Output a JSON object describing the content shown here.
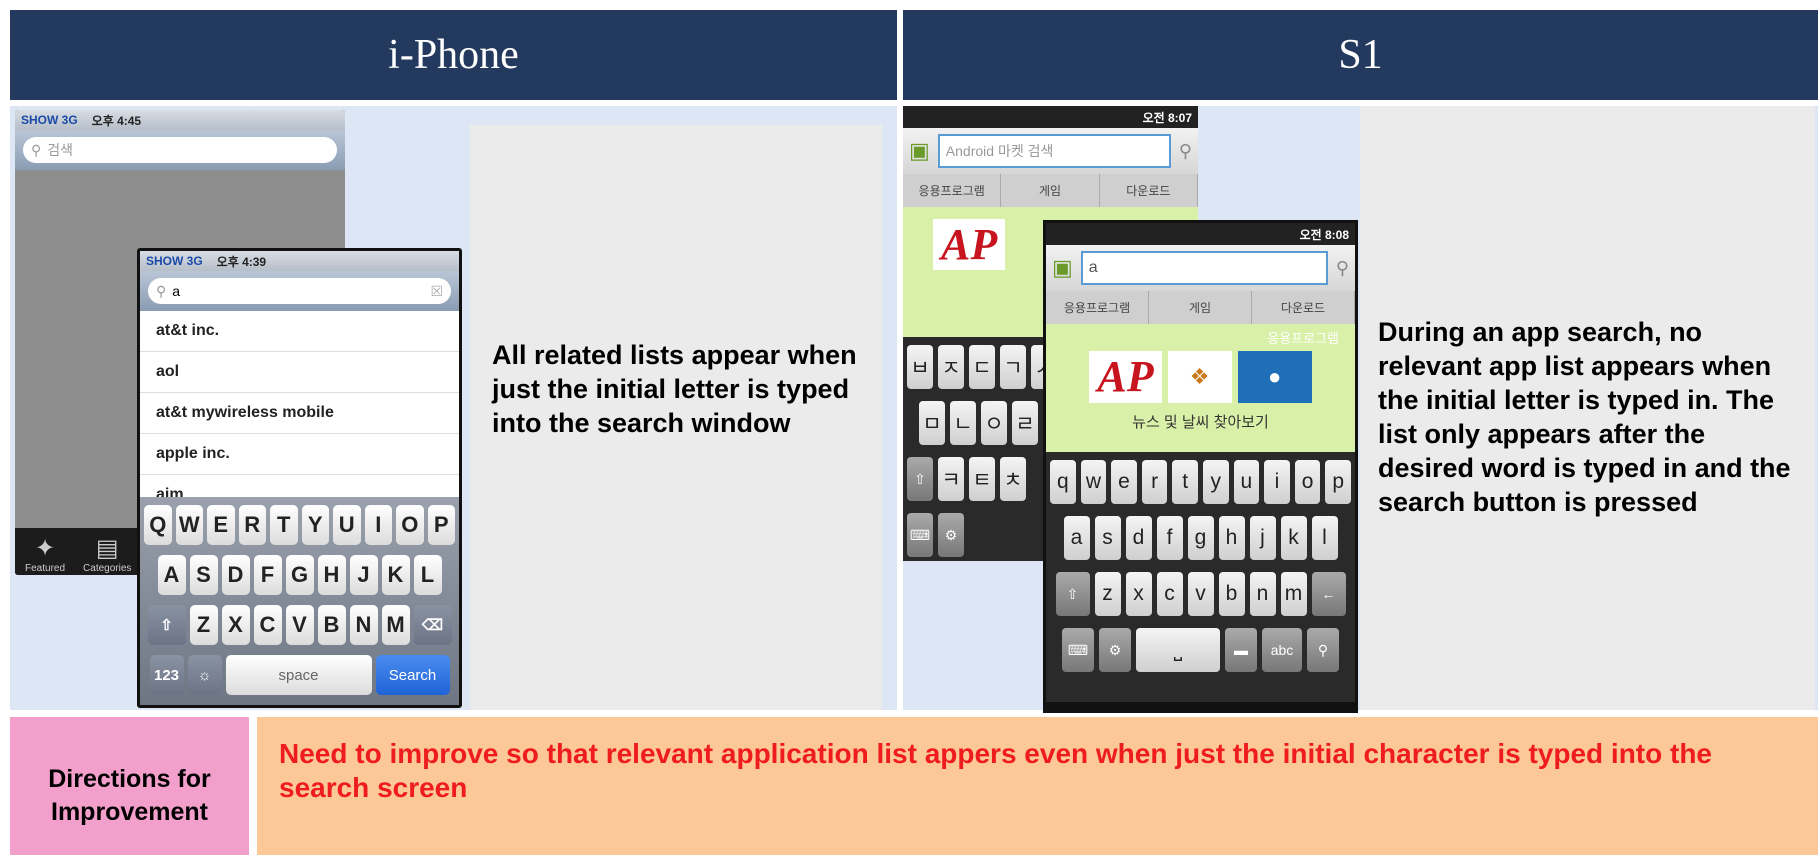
{
  "headers": {
    "left": "i-Phone",
    "right": "S1"
  },
  "iphone": {
    "status_carrier": "SHOW  3G",
    "status_time_back": "오후 4:45",
    "status_time_front": "오후 4:39",
    "search_placeholder": "검색",
    "search_value": "a",
    "results": [
      "at&t inc.",
      "aol",
      "at&t mywireless mobile",
      "apple inc.",
      "aim"
    ],
    "keyboard_row1": [
      "Q",
      "W",
      "E",
      "R",
      "T",
      "Y",
      "U",
      "I",
      "O",
      "P"
    ],
    "keyboard_row2": [
      "A",
      "S",
      "D",
      "F",
      "G",
      "H",
      "J",
      "K",
      "L"
    ],
    "keyboard_row3": [
      "Z",
      "X",
      "C",
      "V",
      "B",
      "N",
      "M"
    ],
    "key_123": "123",
    "key_space": "space",
    "key_search": "Search",
    "tab_featured": "Featured",
    "tab_categories": "Categories"
  },
  "s1": {
    "status_time_back": "오전 8:07",
    "status_time_front": "오전 8:08",
    "search_placeholder": "Android 마켓 검색",
    "search_value": "a",
    "tabs": [
      "응용프로그램",
      "게임",
      "다운로드"
    ],
    "banner_heading": "응용프로그램",
    "banner_caption": "뉴스 및 날씨 찾아보기",
    "keyboard_row1": [
      "q",
      "w",
      "e",
      "r",
      "t",
      "y",
      "u",
      "i",
      "o",
      "p"
    ],
    "keyboard_row2": [
      "a",
      "s",
      "d",
      "f",
      "g",
      "h",
      "j",
      "k",
      "l"
    ],
    "keyboard_row3": [
      "z",
      "x",
      "c",
      "v",
      "b",
      "n",
      "m"
    ],
    "key_abc": "abc",
    "back_korean_row1": [
      "ㅂ",
      "ㅈ",
      "ㄷ",
      "ㄱ",
      "ㅅ"
    ],
    "back_korean_row2": [
      "ㅁ",
      "ㄴ",
      "ㅇ",
      "ㄹ"
    ],
    "back_korean_row3": [
      "ㅋ",
      "ㅌ",
      "ㅊ"
    ]
  },
  "descriptions": {
    "iphone": "All related lists appear when just the initial letter is typed into the search window",
    "s1": "During an app search, no relevant app list appears when the initial letter is typed in. The list only appears after the desired word is typed in and the search button is pressed"
  },
  "improvement": {
    "label": "Directions for Improvement",
    "text": "Need to improve so that relevant application list appers even when just the initial character is typed into the search screen"
  },
  "colors": {
    "header": "#233a5e",
    "pink": "#f39fcb",
    "peach": "#fdc897",
    "red_text": "#ee1c1c"
  }
}
